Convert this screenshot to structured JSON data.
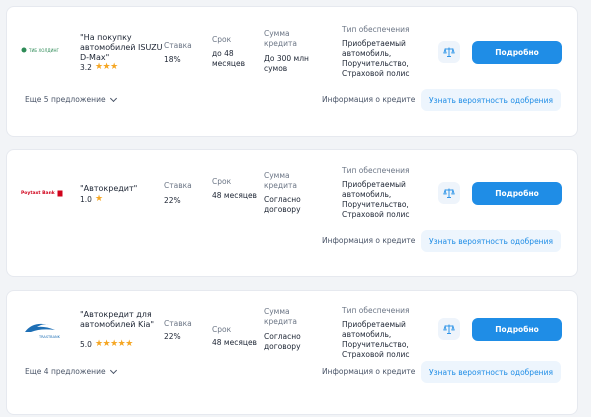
{
  "labels": {
    "rate": "Ставка",
    "term": "Срок",
    "amount": "Сумма кредита",
    "collateral": "Тип обеспечения",
    "details": "Подробно",
    "credit_info": "Информация о кредите",
    "approval": "Узнать вероятность одобрения"
  },
  "offers": [
    {
      "bank_logo_text": "ТИБ ХОЛДИНГ",
      "title": "\"На покупку автомобилей ISUZU D-Max\"",
      "rating": "3.2",
      "stars": "★★★",
      "rate": "18%",
      "term": "до 48 месяцев",
      "amount": "До 300 млн сумов",
      "collateral": "Приобретаемый автомобиль, Поручительство, Страховой полис",
      "more": "Еще 5 предложение"
    },
    {
      "bank_logo_text": "Poytaxt Bank",
      "title": "\"Автокредит\"",
      "rating": "1.0",
      "stars": "★",
      "rate": "22%",
      "term": "48 месяцев",
      "amount": "Согласно договору",
      "collateral": "Приобретаемый автомобиль, Поручительство, Страховой полис",
      "more": ""
    },
    {
      "bank_logo_text": "TRASTBANK",
      "title": "\"Автокредит для автомобилей Kia\"",
      "rating": "5.0",
      "stars": "★★★★★",
      "rate": "22%",
      "term": "48 месяцев",
      "amount": "Согласно договору",
      "collateral": "Приобретаемый автомобиль, Поручительство, Страховой полис",
      "more": "Еще 4 предложение"
    }
  ],
  "colors": {
    "primary": "#1f8de6",
    "star": "#f5a623",
    "background": "#f2f4f7"
  },
  "icons": {
    "compare": "scales-icon",
    "expand": "chevron-down-icon"
  }
}
